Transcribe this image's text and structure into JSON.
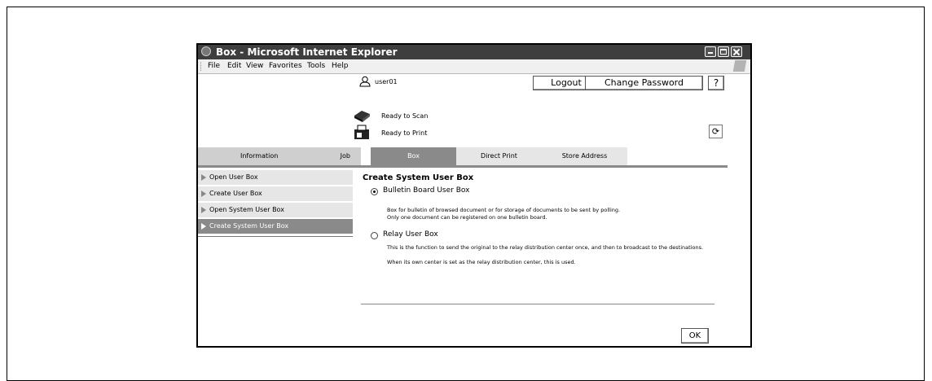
{
  "window": {
    "title": "Box - Microsoft Internet Explorer"
  },
  "menu": [
    "File",
    "Edit",
    "View",
    "Favorites",
    "Tools",
    "Help"
  ],
  "header": {
    "user": "user01",
    "logout_label": "Logout",
    "change_password_label": "Change Password",
    "help_label": "?"
  },
  "status": {
    "scan": "Ready to Scan",
    "print": "Ready to Print"
  },
  "tabs": {
    "information": "Information",
    "job": "Job",
    "box": "Box",
    "direct_print": "Direct Print",
    "store_address": "Store Address"
  },
  "sidebar": {
    "items": [
      {
        "label": "Open User Box"
      },
      {
        "label": "Create User Box"
      },
      {
        "label": "Open System User Box"
      },
      {
        "label": "Create System User Box"
      }
    ]
  },
  "main": {
    "heading": "Create System User Box",
    "options": [
      {
        "label": "Bulletin Board User Box",
        "selected": true,
        "desc1": "Box for bulletin of browsed document or for storage of documents to be sent by polling.",
        "desc2": "Only one document can be registered on one bulletin board."
      },
      {
        "label": "Relay User Box",
        "selected": false,
        "desc1": "This is the function to send the original to the relay distribution center once, and then to broadcast to the destinations.",
        "desc2": "When its own center is set as the relay distribution center, this is used."
      }
    ],
    "ok_label": "OK"
  }
}
